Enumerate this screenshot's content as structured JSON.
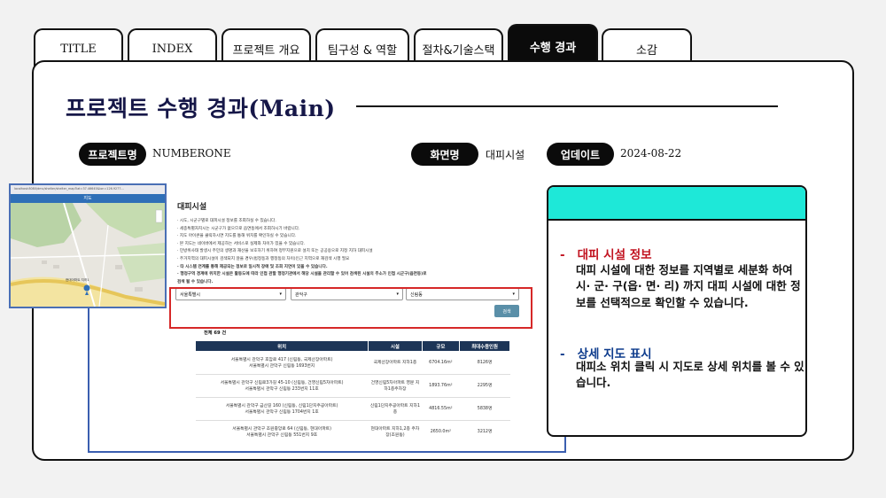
{
  "tabs": [
    {
      "label": "TITLE",
      "active": false
    },
    {
      "label": "INDEX",
      "active": false
    },
    {
      "label": "프로젝트 개요",
      "active": false
    },
    {
      "label": "팀구성 & 역할",
      "active": false
    },
    {
      "label": "절차&기술스택",
      "active": false
    },
    {
      "label": "수행 경과",
      "active": true
    },
    {
      "label": "소감",
      "active": false
    }
  ],
  "header": {
    "title": "프로젝트 수행 경과(Main)"
  },
  "meta": {
    "project_label": "프로젝트명",
    "project_value": "NUMBERONE",
    "screen_label": "화면명",
    "screen_value": "대피시설",
    "update_label": "업데이트",
    "update_value": "2024-08-22"
  },
  "webshot": {
    "title": "대피시설",
    "bullets": [
      "· 시도, 시군구별로 대피시설 정보를 조회하실 수 있습니다.",
      "· 세종특별자치시는 시군구가 없으므로 읍면동에서 조회하시기 바랍니다.",
      "· 지도 아이콘을 클릭하시면 지도를 통해 위치를 확인하실 수 있습니다.",
      "· 본 지도는 네이버에서 제공하는 서비스로 실제와 차이가 있을 수 있습니다.",
      "· 민방위사태 발생시 주민의 생명과 재산을 보호하기 위하여 정부지원으로 설치 또는 공공용으로 지정 지하 대피시설",
      "· 주거지역의 대피시설이 검색되지 않을 경우(법정동과 행정동의 차이)인근 지역으로 재검색 시행 필요",
      "· 타 시스템 연계를 통해 제공되는 정보로 일시적 장애 및 조회 지연이 있을 수 있습니다.",
      "· 행정구역 경계에 위치한 시설은 활동도에 따라 인접 관할 행정기관에서 해당 시설을 관리할 수 있어 검색된 시설의 주소가 인접 시군구(읍면동)로",
      "  검색 될 수 있습니다."
    ],
    "selects": [
      "서울특별시",
      "관악구",
      "신림동"
    ],
    "search_label": "검색",
    "count": "전체 69 건",
    "columns": [
      "위치",
      "시설",
      "규모",
      "최대수용인원"
    ],
    "rows": [
      {
        "loc1": "서울특별시 관악구 호암로 417 (신림동, 국제산장아파트)",
        "loc2": "서울특별시 관악구 신림동 1693번지",
        "facility": "국제산장아파트 지하1층",
        "size": "6704.16m²",
        "cap": "8126명"
      },
      {
        "loc1": "서울특별시 관악구 신림로3가길 45-10 (신림동, 건영신림5차아파트)",
        "loc2": "서울특별시 관악구 신림동 233번지 11호",
        "facility": "건영신림5차아파트 영문 지하1층주차장",
        "size": "1893.76m²",
        "cap": "2295명"
      },
      {
        "loc1": "서울특별시 관악구 금산길 160 (신림동, 신림1단지주공아파트)",
        "loc2": "서울특별시 관악구 신림동 1704번지 1호",
        "facility": "신림1단지주공아파트 지하1층",
        "size": "4816.55m²",
        "cap": "5838명"
      },
      {
        "loc1": "서울특별시 관악구 조원중앙로 64 (신림동, 현대아파트)",
        "loc2": "서울특별시 관악구 신림동 551번지 9호",
        "facility": "현대아파트 지하1,2층 주차장(조원동)",
        "size": "2650.0m²",
        "cap": "3212명"
      }
    ]
  },
  "map": {
    "url": "localhost:8080/dmc/shelter/shelter_map?lat=37.46645&lon=126.9277...",
    "bar_label": "지도"
  },
  "info": {
    "section1_title": "대피 시설 정보",
    "section1_body": "대피 시설에 대한 정보를 지역별로 세분화 하여 시· 군· 구(읍· 면· 리) 까지 대피 시설에 대한 정보를 선택적으로 확인할 수 있습니다.",
    "section2_title": "상세 지도 표시",
    "section2_body": "대피소 위치 클릭 시 지도로 상세 위치를 볼 수 있습니다."
  },
  "colors": {
    "accent_cyan": "#1ee8d8",
    "title_navy": "#161748",
    "highlight_red": "#d62828",
    "connector_blue": "#3b5fb0"
  }
}
